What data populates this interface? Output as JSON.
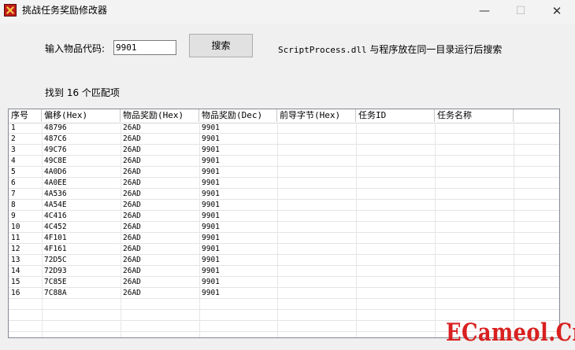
{
  "window": {
    "title": "挑战任务奖励修改器",
    "min_glyph": "—",
    "max_glyph": "☐",
    "close_glyph": "✕"
  },
  "form": {
    "code_label": "输入物品代码:",
    "code_value": "9901",
    "search_label": "搜索",
    "note_file": "ScriptProcess.dll",
    "note_text": " 与程序放在同一目录运行后搜索",
    "result": "找到 16 个匹配项"
  },
  "table": {
    "columns": [
      "序号",
      "偏移(Hex)",
      "物品奖励(Hex)",
      "物品奖励(Dec)",
      "前导字节(Hex)",
      "任务ID",
      "任务名称"
    ],
    "rows": [
      [
        "1",
        "48796",
        "26AD",
        "9901",
        "",
        "",
        ""
      ],
      [
        "2",
        "487C6",
        "26AD",
        "9901",
        "",
        "",
        ""
      ],
      [
        "3",
        "49C76",
        "26AD",
        "9901",
        "",
        "",
        ""
      ],
      [
        "4",
        "49C8E",
        "26AD",
        "9901",
        "",
        "",
        ""
      ],
      [
        "5",
        "4A0D6",
        "26AD",
        "9901",
        "",
        "",
        ""
      ],
      [
        "6",
        "4A0EE",
        "26AD",
        "9901",
        "",
        "",
        ""
      ],
      [
        "7",
        "4A536",
        "26AD",
        "9901",
        "",
        "",
        ""
      ],
      [
        "8",
        "4A54E",
        "26AD",
        "9901",
        "",
        "",
        ""
      ],
      [
        "9",
        "4C416",
        "26AD",
        "9901",
        "",
        "",
        ""
      ],
      [
        "10",
        "4C452",
        "26AD",
        "9901",
        "",
        "",
        ""
      ],
      [
        "11",
        "4F101",
        "26AD",
        "9901",
        "",
        "",
        ""
      ],
      [
        "12",
        "4F161",
        "26AD",
        "9901",
        "",
        "",
        ""
      ],
      [
        "13",
        "72D5C",
        "26AD",
        "9901",
        "",
        "",
        ""
      ],
      [
        "14",
        "72D93",
        "26AD",
        "9901",
        "",
        "",
        ""
      ],
      [
        "15",
        "7C85E",
        "26AD",
        "9901",
        "",
        "",
        ""
      ],
      [
        "16",
        "7C88A",
        "26AD",
        "9901",
        "",
        "",
        ""
      ]
    ]
  },
  "watermark": "ECameol.Cn"
}
